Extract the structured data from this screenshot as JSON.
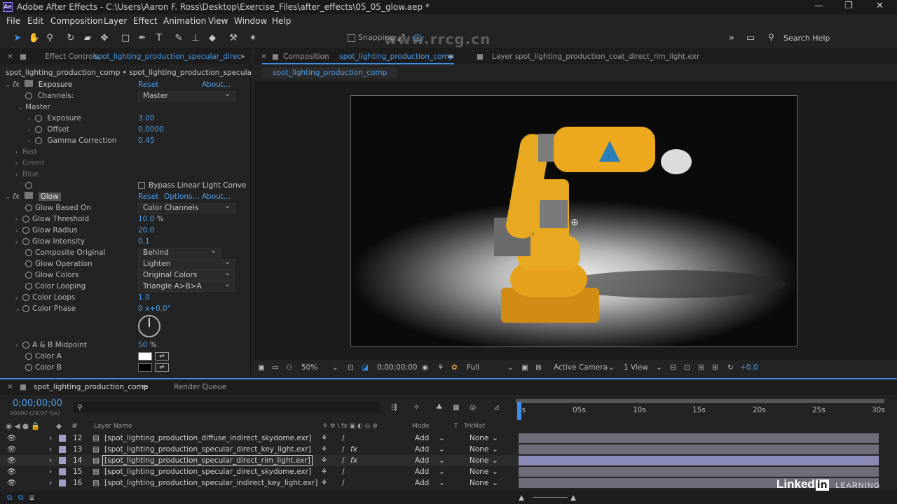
{
  "window": {
    "title": "Adobe After Effects - C:\\Users\\Aaron F. Ross\\Desktop\\Exercise_Files\\after_effects\\05_05_glow.aep *",
    "app_icon": "Ae",
    "controls": [
      "—",
      "❐",
      "✕"
    ]
  },
  "menu": [
    "File",
    "Edit",
    "Composition",
    "Layer",
    "Effect",
    "Animation",
    "View",
    "Window",
    "Help"
  ],
  "toolbar": {
    "snapping_label": "Snapping",
    "search_placeholder": "Search Help",
    "icons": [
      "selection-tool-icon",
      "hand-tool-icon",
      "zoom-tool-icon",
      "rotate-tool-icon",
      "camera-tool-icon",
      "pan-behind-tool-icon",
      "rectangle-tool-icon",
      "pen-tool-icon",
      "type-tool-icon",
      "brush-tool-icon",
      "clone-stamp-tool-icon",
      "eraser-tool-icon",
      "roto-brush-tool-icon",
      "puppet-tool-icon"
    ]
  },
  "effect_controls": {
    "tab_prefix": "Effect Controls",
    "tab_layer": "spot_lighting_production_specular_direc",
    "breadcrumb": "spot_lighting_production_comp • spot_lighting_production_specular_direct_",
    "exposure": {
      "name": "Exposure",
      "reset": "Reset",
      "about": "About...",
      "channels_label": "Channels:",
      "channels_value": "Master",
      "master_label": "Master",
      "params": [
        {
          "label": "Exposure",
          "value": "3.00"
        },
        {
          "label": "Offset",
          "value": "0.0000"
        },
        {
          "label": "Gamma Correction",
          "value": "0.45"
        }
      ],
      "disabled_groups": [
        "Red",
        "Green",
        "Blue"
      ],
      "bypass_label": "Bypass Linear Light Conve"
    },
    "glow": {
      "name": "Glow",
      "reset": "Reset",
      "options": "Options...",
      "about": "About...",
      "params": [
        {
          "label": "Glow Based On",
          "value": "Color Channels",
          "type": "dropdown"
        },
        {
          "label": "Glow Threshold",
          "value": "10.0",
          "unit": "%",
          "type": "number"
        },
        {
          "label": "Glow Radius",
          "value": "20.0",
          "type": "number"
        },
        {
          "label": "Glow Intensity",
          "value": "0.1",
          "type": "number"
        },
        {
          "label": "Composite Original",
          "value": "Behind",
          "type": "dropdown"
        },
        {
          "label": "Glow Operation",
          "value": "Lighten",
          "type": "dropdown"
        },
        {
          "label": "Glow Colors",
          "value": "Original Colors",
          "type": "dropdown"
        },
        {
          "label": "Color Looping",
          "value": "Triangle A>B>A",
          "type": "dropdown"
        },
        {
          "label": "Color Loops",
          "value": "1.0",
          "type": "number"
        },
        {
          "label": "Color Phase",
          "value": "0 x+0.0°",
          "type": "number"
        }
      ],
      "midpoint_label": "A & B Midpoint",
      "midpoint_value": "50",
      "midpoint_unit": "%",
      "color_a_label": "Color A",
      "color_b_label": "Color B",
      "color_a": "#ffffff",
      "color_b": "#000000"
    }
  },
  "composition": {
    "tab_prefix": "Composition",
    "tab_name": "spot_lighting_production_comp",
    "layer_tab": "Layer  spot_lighting_production_coat_direct_rim_light.exr",
    "subtab": "spot_lighting_production_comp",
    "viewer_footer": {
      "zoom": "50%",
      "timecode": "0;00;00;00",
      "resolution": "Full",
      "camera": "Active Camera",
      "view": "1 View",
      "exposure": "+0.0"
    }
  },
  "watermark": "www.rrcg.cn",
  "timeline": {
    "tab_comp": "spot_lighting_production_comp",
    "tab_render": "Render Queue",
    "timecode": "0;00;00;00",
    "fps": "00000 (29.97 fps)",
    "columns": {
      "layer_name": "Layer Name",
      "mode": "Mode",
      "t": "T",
      "trkmat": "TrkMat"
    },
    "ruler": [
      "0s",
      "05s",
      "10s",
      "15s",
      "20s",
      "25s",
      "30s"
    ],
    "layers": [
      {
        "num": "12",
        "name": "[spot_lighting_production_diffuse_indirect_skydome.exr]",
        "mode": "Add",
        "trkmat": "None",
        "fx": false
      },
      {
        "num": "13",
        "name": "[spot_lighting_production_specular_direct_key_light.exr]",
        "mode": "Add",
        "trkmat": "None",
        "fx": true
      },
      {
        "num": "14",
        "name": "[spot_lighting_production_specular_direct_rim_light.exr]",
        "mode": "Add",
        "trkmat": "None",
        "fx": true
      },
      {
        "num": "15",
        "name": "[spot_lighting_production_specular_direct_skydome.exr]",
        "mode": "Add",
        "trkmat": "None",
        "fx": false
      },
      {
        "num": "16",
        "name": "[spot_lighting_production_specular_indirect_key_light.exr]",
        "mode": "Add",
        "trkmat": "None",
        "fx": false
      }
    ]
  },
  "branding": {
    "linkedin": "Linked",
    "in": "in",
    "learning": "LEARNING"
  },
  "colors": {
    "accent": "#4d9de8",
    "robot": "#e8a21c",
    "panel": "#232323"
  }
}
